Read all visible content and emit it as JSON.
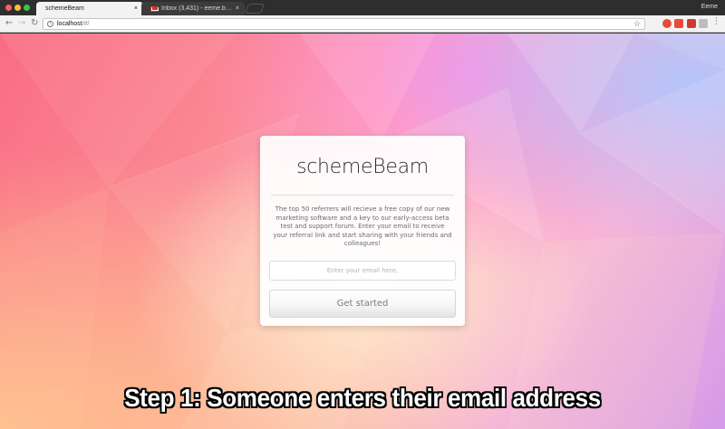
{
  "browser": {
    "tabs": [
      {
        "label": "schemeBeam",
        "active": true,
        "close": "×"
      },
      {
        "label": "Inbox (3,431) - eeme.barbo...",
        "active": false,
        "close": "×"
      }
    ],
    "profile_name": "Eeme",
    "nav": {
      "back": "←",
      "forward": "→",
      "reload": "↻"
    },
    "url_host": "localhost",
    "url_path": "/#/",
    "star": "☆",
    "menu": "⋮"
  },
  "page": {
    "brand": "schemeBeam",
    "blurb": "The top 50 referrers will recieve a free copy of our new marketing software and a key to our early-access beta test and support forum. Enter your email to receive your referral link and start sharing with your friends and colleagues!",
    "email_placeholder": "Enter your email here.",
    "cta_label": "Get started",
    "caption": "Step 1: Someone enters their email address"
  },
  "colors": {
    "bg_pink": "#f96d84",
    "bg_violet": "#d59ae8",
    "brand_text": "#2d2d33"
  }
}
